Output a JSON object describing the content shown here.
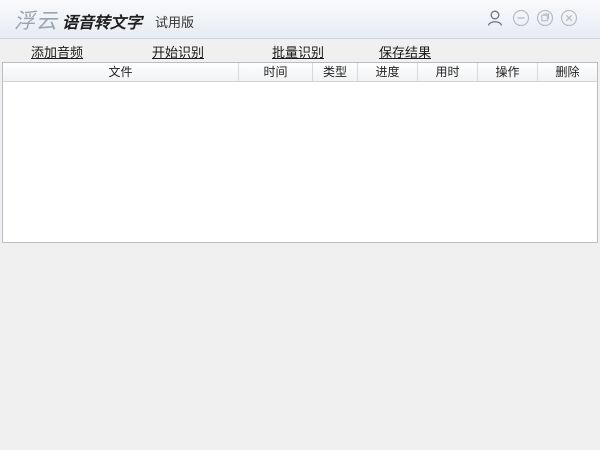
{
  "titlebar": {
    "brand": "浮云",
    "app_name": "语音转文字",
    "edition": "试用版",
    "icons": [
      "user-icon",
      "minimize-icon",
      "restore-icon",
      "close-icon"
    ]
  },
  "menu": {
    "add_audio": "添加音频",
    "start_recognition": "开始识别",
    "batch_recognition": "批量识别",
    "save_results": "保存结果"
  },
  "table": {
    "columns": [
      "文件",
      "时间",
      "类型",
      "进度",
      "用时",
      "操作",
      "删除"
    ],
    "rows": []
  }
}
